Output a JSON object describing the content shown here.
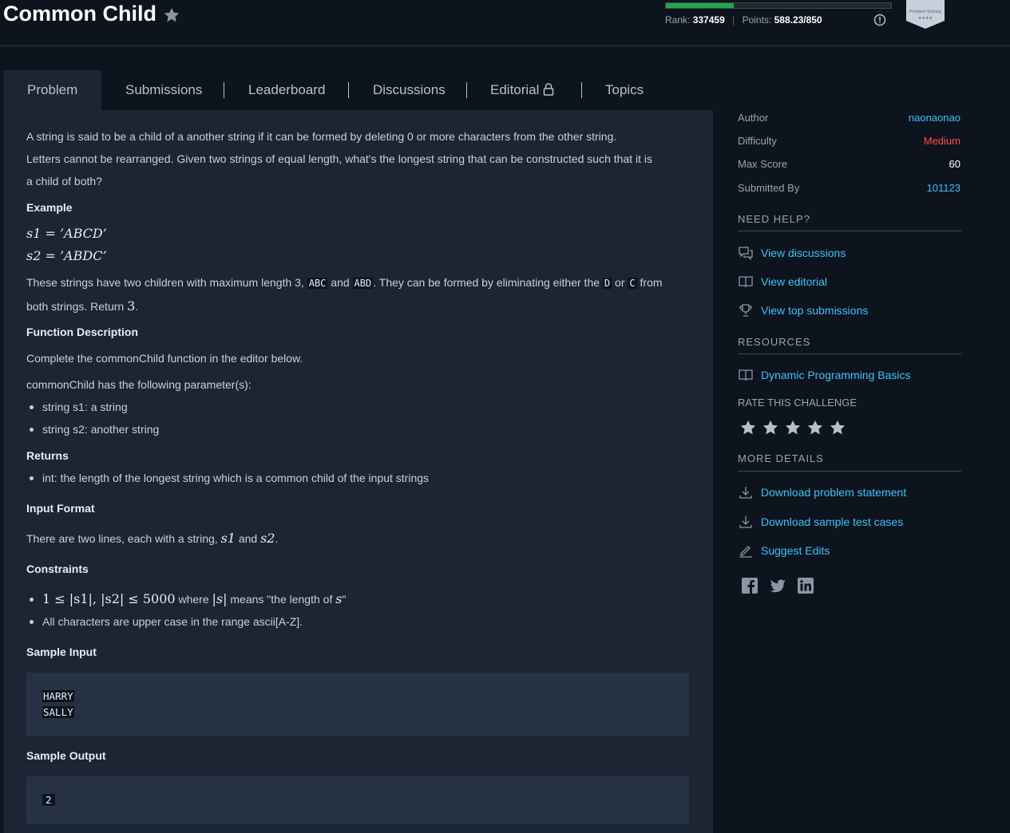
{
  "header": {
    "title": "Common Child",
    "progress_fraction": 0.3,
    "rank_label": "Rank:",
    "rank_value": "337459",
    "points_label": "Points:",
    "points_value": "588.23/850",
    "badge_text": "Problem Solving",
    "badge_stars": "★★★★"
  },
  "tabs": [
    {
      "label": "Problem"
    },
    {
      "label": "Submissions"
    },
    {
      "label": "Leaderboard"
    },
    {
      "label": "Discussions"
    },
    {
      "label": "Editorial"
    },
    {
      "label": "Topics"
    }
  ],
  "problem": {
    "intro": [
      "A string is said to be a child of a another string if it can be formed by deleting 0 or more characters from the other string.",
      "Letters cannot be rearranged. Given two strings of equal length, what's the longest string that can be constructed such that it is",
      "a child of both?"
    ],
    "example_heading": "Example",
    "s1_eq": "s1 =  ’ABCD’",
    "s2_eq": "s2 =  ’ABDC’",
    "children_1": "These strings have two children with maximum length 3,",
    "code_abc": "ABC",
    "and_word": "and",
    "code_abd": "ABD",
    "children_2": ". They can be formed by eliminating either the",
    "code_d": "D",
    "or_word": "or",
    "code_c": "C",
    "from_word": "from",
    "children_3": "both strings. Return",
    "return_val": "3",
    "period": ".",
    "func_heading": "Function Description",
    "func_text": "Complete the commonChild function in the editor below.",
    "params_text": "commonChild has the following parameter(s):",
    "param_1": "string s1: a string",
    "param_2": "string s2: another string",
    "returns_heading": "Returns",
    "returns_text": "int: the length of the longest string which is a common child of the input strings",
    "input_heading": "Input Format",
    "input_text_1": "There are two lines, each with a string,",
    "input_s1": "s1",
    "input_and": "and",
    "input_s2": "s2",
    "input_period": ".",
    "constraints_heading": "Constraints",
    "constraint_math": "1 ≤ |s1|, |s2| ≤ 5000",
    "constraint_where": "where",
    "constraint_abs": "|s|",
    "constraint_means": "means \"the length of",
    "constraint_s": "s",
    "constraint_end": "\"",
    "constraint_2": "All characters are upper case in the range ascii[A-Z].",
    "sample_input_heading": "Sample Input",
    "sample_input_lines": [
      "HARRY",
      "SALLY"
    ],
    "sample_output_heading": "Sample Output",
    "sample_output": "2"
  },
  "sidebar": {
    "author_label": "Author",
    "author_value": "naonaonao",
    "difficulty_label": "Difficulty",
    "difficulty_value": "Medium",
    "max_score_label": "Max Score",
    "max_score_value": "60",
    "submitted_label": "Submitted By",
    "submitted_value": "101123",
    "need_help": "NEED HELP?",
    "view_discussions": "View discussions",
    "view_editorial": "View editorial",
    "view_top": "View top submissions",
    "resources": "RESOURCES",
    "dp_basics": "Dynamic Programming Basics",
    "rate_title": "RATE THIS CHALLENGE",
    "more_details": "MORE DETAILS",
    "download_statement": "Download problem statement",
    "download_tests": "Download sample test cases",
    "suggest_edits": "Suggest Edits"
  },
  "colors": {
    "link": "#39c3f6",
    "medium": "#ff4d4d",
    "progress": "#1ba94c",
    "background": "#0e141e",
    "panel": "#1b2533"
  }
}
